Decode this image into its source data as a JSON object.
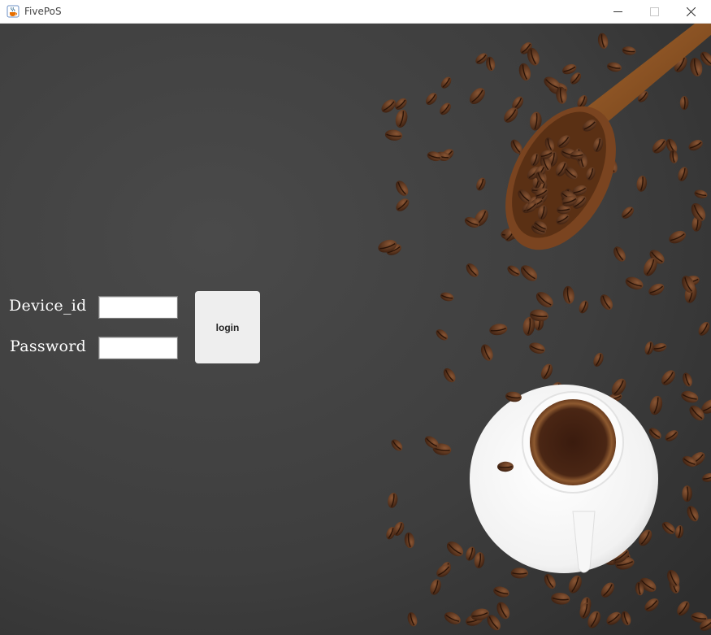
{
  "window": {
    "title": "FivePoS",
    "icon": "java-cup-icon",
    "controls": {
      "minimize": "minimize-icon",
      "maximize": "maximize-icon",
      "close": "close-icon"
    }
  },
  "background": {
    "description_icon": "coffee-cup-and-beans-image",
    "colors": {
      "board": "#3d3d3d",
      "bean": "#5a3420",
      "scoop": "#8a5226",
      "saucer": "#f4f4f4",
      "coffee": "#3b1d10",
      "crema": "#a8703e"
    }
  },
  "login_form": {
    "device_label": "Device_id",
    "device_value": "",
    "password_label": "Password",
    "password_value": "",
    "login_button": "login"
  }
}
